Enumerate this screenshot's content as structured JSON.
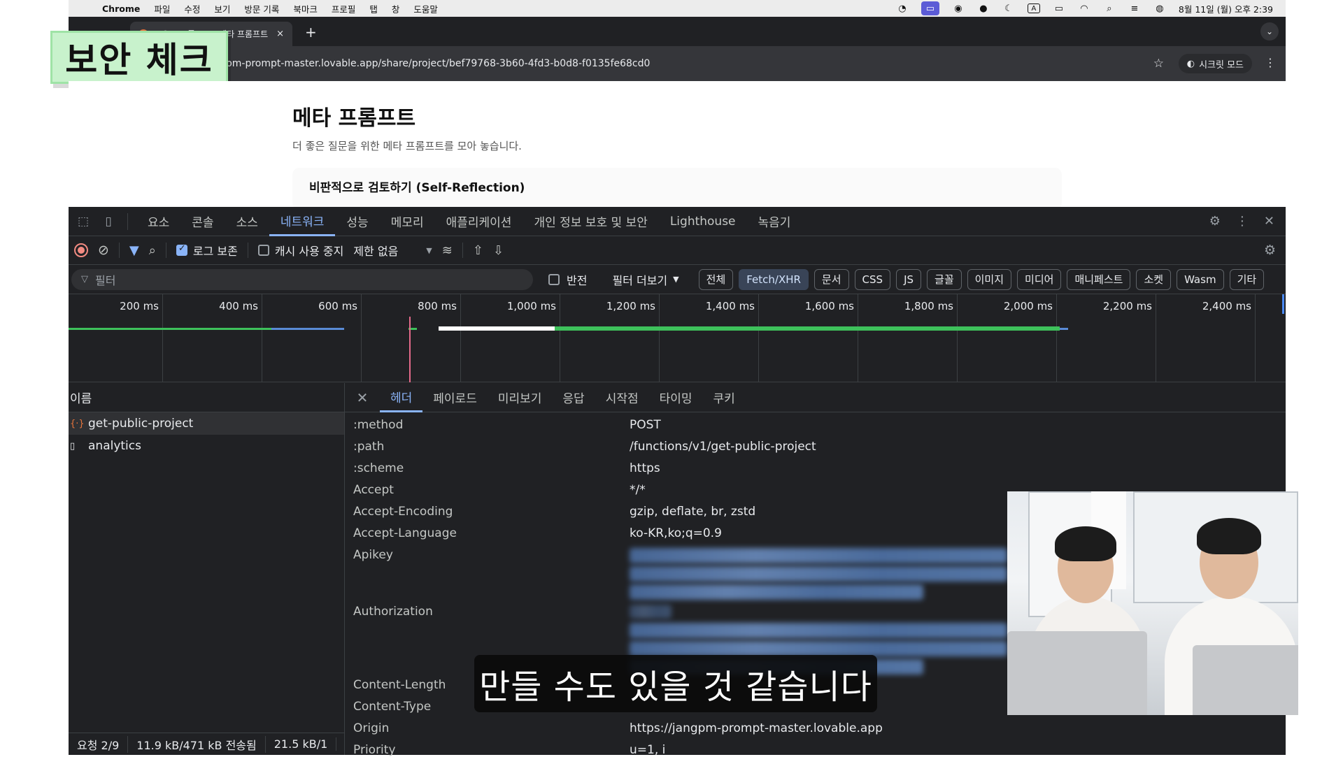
{
  "menubar": {
    "app": "Chrome",
    "items": [
      "파일",
      "수정",
      "보기",
      "방문 기록",
      "북마크",
      "프로필",
      "탭",
      "창",
      "도움말"
    ],
    "clock": "8월 11일 (월) 오후 2:39",
    "input_indicator": "A"
  },
  "browser": {
    "tab_title": "코오드 프롬프트 - 메타 프롬프트",
    "tab_close": "×",
    "new_tab": "+",
    "url": "gpm-prompt-master.lovable.app/share/project/bef79768-3b60-4fd3-b0d8-f0135fe68cd0",
    "incognito_label": "시크릿 모드"
  },
  "badge": {
    "text": "보안 체크"
  },
  "page": {
    "title": "메타 프롬프트",
    "subtitle": "더 좋은 질문을 위한 메타 프롬프트를 모아 놓습니다.",
    "card_title": "비판적으로 검토하기 (Self-Reflection)"
  },
  "devtools": {
    "tabs": [
      "요소",
      "콘솔",
      "소스",
      "네트워크",
      "성능",
      "메모리",
      "애플리케이션",
      "개인 정보 보호 및 보안",
      "Lighthouse",
      "녹음기"
    ],
    "active_tab": "네트워크",
    "controls": {
      "preserve_log": "로그 보존",
      "disable_cache": "캐시 사용 중지",
      "throttle": "제한 없음"
    },
    "filter": {
      "placeholder": "필터",
      "invert": "반전",
      "more_filters": "필터 더보기",
      "chips": [
        "전체",
        "Fetch/XHR",
        "문서",
        "CSS",
        "JS",
        "글꼴",
        "이미지",
        "미디어",
        "매니페스트",
        "소켓",
        "Wasm",
        "기타"
      ],
      "active_chip": "Fetch/XHR"
    },
    "timeline_ticks": [
      "200 ms",
      "400 ms",
      "600 ms",
      "800 ms",
      "1,000 ms",
      "1,200 ms",
      "1,400 ms",
      "1,600 ms",
      "1,800 ms",
      "2,000 ms",
      "2,200 ms",
      "2,400 ms"
    ],
    "requests_header": "이름",
    "requests": [
      {
        "name": "get-public-project",
        "type": "fetch",
        "icon": "fetch-icon"
      },
      {
        "name": "analytics",
        "type": "document",
        "icon": "document-icon"
      }
    ],
    "status": {
      "requests": "요청 2/9",
      "transferred": "11.9 kB/471 kB 전송됨",
      "resources": "21.5 kB/1"
    },
    "detail_tabs": [
      "헤더",
      "페이로드",
      "미리보기",
      "응답",
      "시작점",
      "타이밍",
      "쿠키"
    ],
    "active_detail_tab": "헤더",
    "headers": [
      {
        "key": ":method",
        "value": "POST"
      },
      {
        "key": ":path",
        "value": "/functions/v1/get-public-project"
      },
      {
        "key": ":scheme",
        "value": "https"
      },
      {
        "key": "Accept",
        "value": "*/*"
      },
      {
        "key": "Accept-Encoding",
        "value": "gzip, deflate, br, zstd"
      },
      {
        "key": "Accept-Language",
        "value": "ko-KR,ko;q=0.9"
      },
      {
        "key": "Apikey",
        "value": ""
      },
      {
        "key": "Authorization",
        "value": ""
      },
      {
        "key": "Content-Length",
        "value": ""
      },
      {
        "key": "Content-Type",
        "value": ""
      },
      {
        "key": "Origin",
        "value": "https://jangpm-prompt-master.lovable.app"
      },
      {
        "key": "Priority",
        "value": "u=1, i"
      }
    ]
  },
  "subtitle": {
    "text": "만들 수도 있을 것 같습니다"
  },
  "colors": {
    "devtools_bg": "#202124",
    "accent": "#8ab4f8",
    "badge_bg": "#c8f2cc",
    "timeline_green": "#3ec15b"
  }
}
